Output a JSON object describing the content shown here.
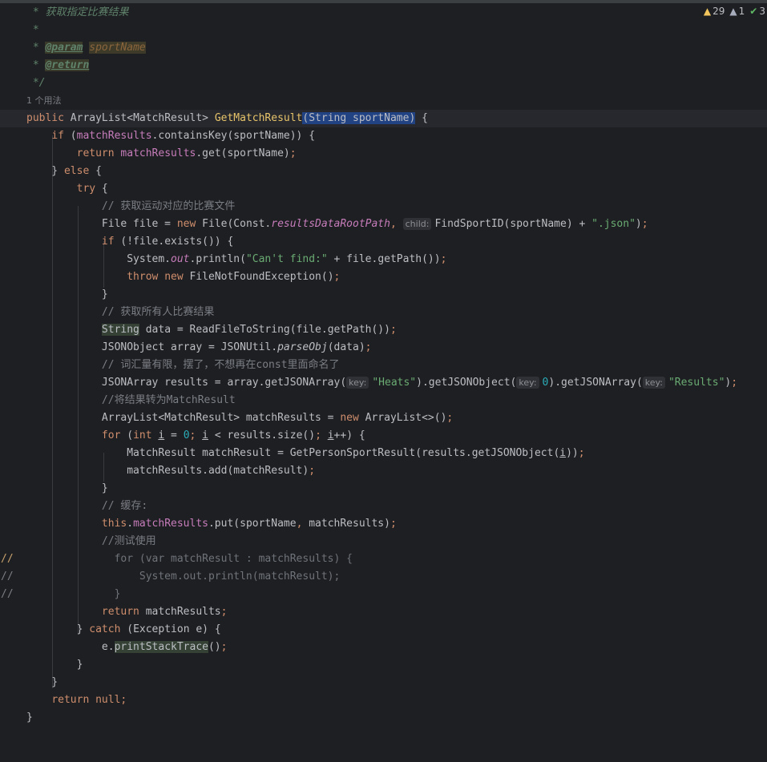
{
  "inspections": {
    "warnings_count": "29",
    "weak_warnings_count": "1",
    "ok_count": "3",
    "warning_color": "#f2c55c",
    "ok_color": "#5fb865"
  },
  "code": {
    "javadoc_desc": "获取指定比赛结果",
    "param_tag": "@param",
    "param_name": "sportName",
    "return_tag": "@return",
    "usages": "1 个用法",
    "method_sig_prefix": "public",
    "return_type": "ArrayList<MatchResult>",
    "method_name": "GetMatchResult",
    "method_params": "(String sportName)",
    "comment_get_file": "// 获取运动对应的比赛文件",
    "const_field": "resultsDataRootPath",
    "hint_child": "child:",
    "json_suffix": "\".json\"",
    "cant_find": "\"Can't find:\"",
    "comment_get_all": "// 获取所有人比赛结果",
    "comment_vocab": "// 词汇量有限，摆了，不想再在const里面命名了",
    "hint_key": "key:",
    "heats": "\"Heats\"",
    "results_key": "\"Results\"",
    "comment_convert": "//将结果转为MatchResult",
    "comment_cache": "// 缓存:",
    "comment_test": "//测试使用",
    "gutter_comment": "//"
  },
  "colors": {
    "background": "#1e1f22",
    "keyword": "#cf8e6d",
    "string": "#6aab73",
    "method_decl": "#e8c46a",
    "field": "#c77dbb",
    "comment": "#7a7e85",
    "selection": "#214283"
  }
}
